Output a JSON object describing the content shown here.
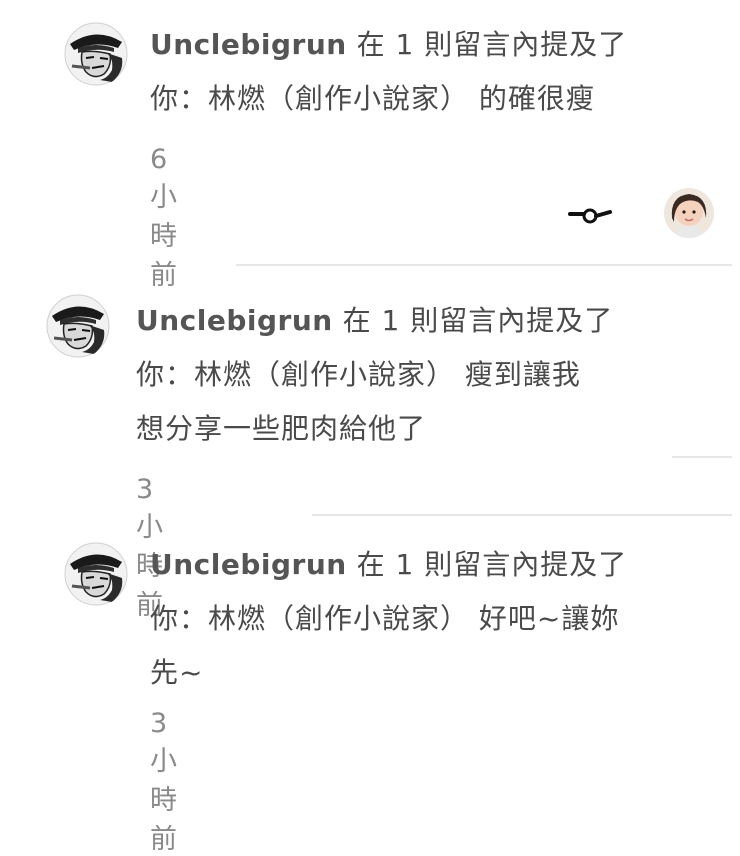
{
  "notifications": [
    {
      "username": "Unclebigrun",
      "mention_text": " 在 1 則留言內提及了",
      "message_line1": "你：林燃（創作小說家） 的確很瘦",
      "message_line2": "",
      "time": "6 小時前"
    },
    {
      "username": "Unclebigrun",
      "mention_text": " 在 1 則留言內提及了",
      "message_line1": "你：林燃（創作小說家） 瘦到讓我",
      "message_line2": "想分享一些肥肉給他了",
      "time": "3 小時前"
    },
    {
      "username": "Unclebigrun",
      "mention_text": " 在 1 則留言內提及了",
      "message_line1": "你：林燃（創作小說家） 好吧~讓妳",
      "message_line2": "先~",
      "time": "3 小時前"
    }
  ],
  "reaction": {
    "icon": "smirk-face-icon",
    "reactor_avatar": "user-avatar-photo"
  },
  "colors": {
    "text": "#4a4a4a",
    "time": "#8a8a8a",
    "divider": "#e6e6e6"
  }
}
